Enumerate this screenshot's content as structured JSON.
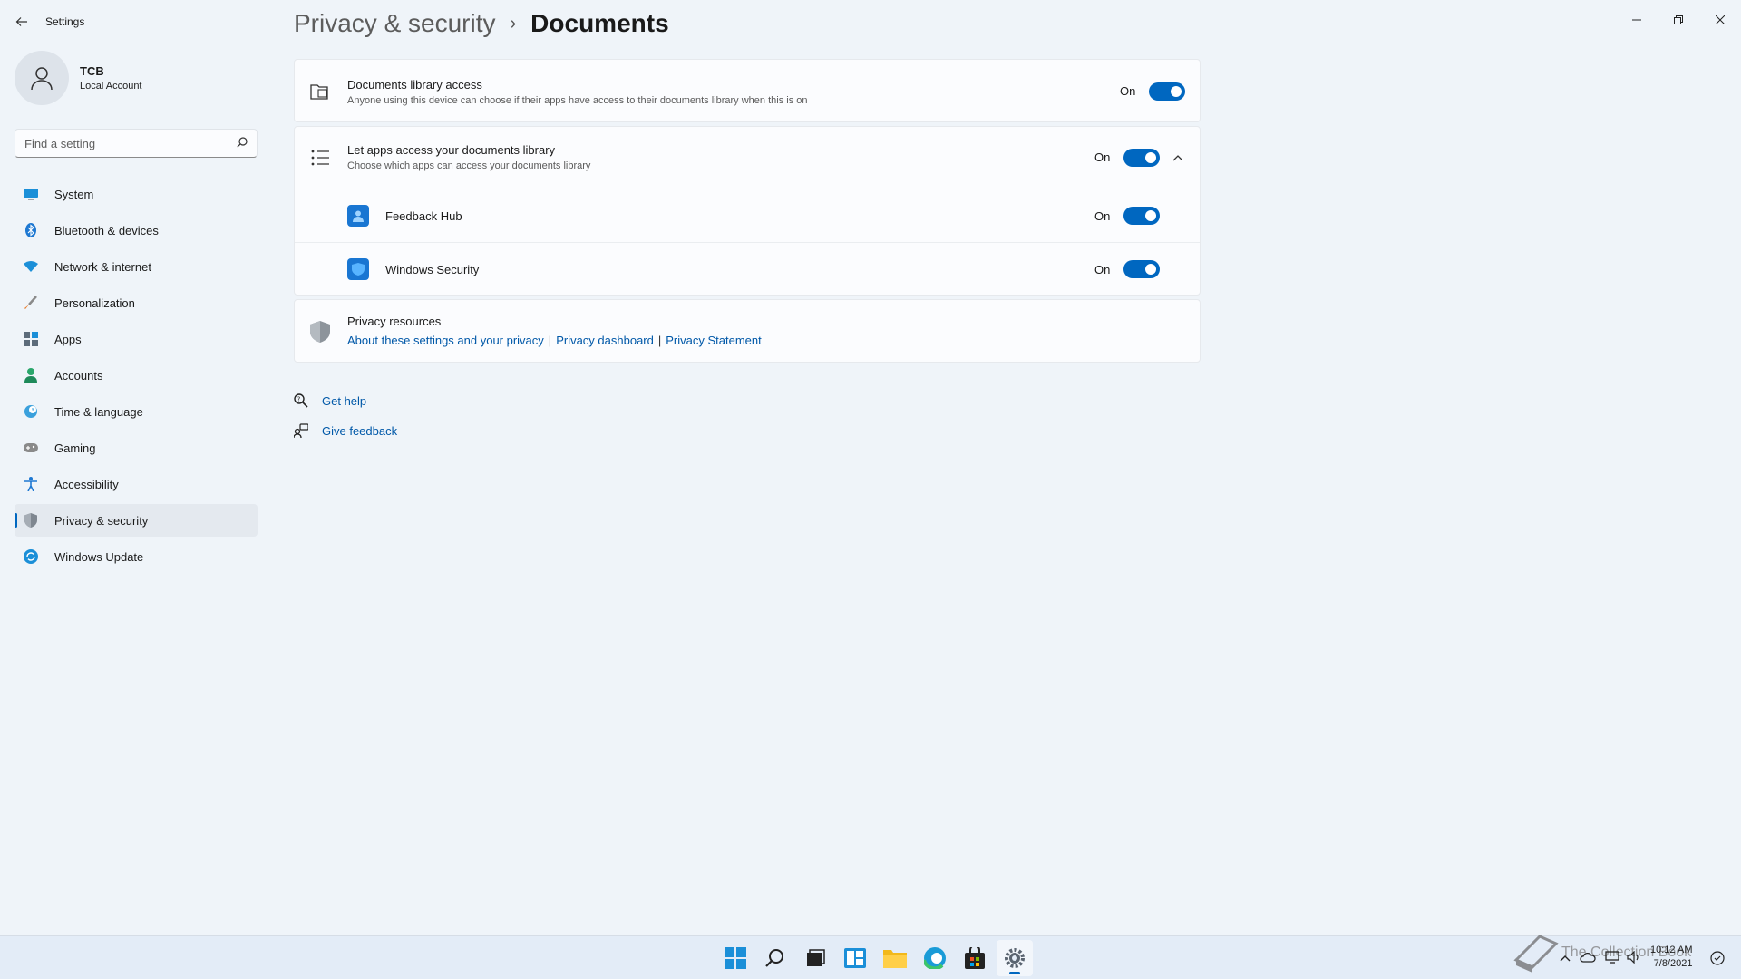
{
  "window": {
    "title": "Settings"
  },
  "user": {
    "name": "TCB",
    "type": "Local Account"
  },
  "search": {
    "placeholder": "Find a setting"
  },
  "sidebar": {
    "items": [
      {
        "label": "System",
        "icon": "monitor-icon"
      },
      {
        "label": "Bluetooth & devices",
        "icon": "bluetooth-icon"
      },
      {
        "label": "Network & internet",
        "icon": "wifi-icon"
      },
      {
        "label": "Personalization",
        "icon": "brush-icon"
      },
      {
        "label": "Apps",
        "icon": "apps-icon"
      },
      {
        "label": "Accounts",
        "icon": "person-icon"
      },
      {
        "label": "Time & language",
        "icon": "globe-clock-icon"
      },
      {
        "label": "Gaming",
        "icon": "gamepad-icon"
      },
      {
        "label": "Accessibility",
        "icon": "accessibility-icon"
      },
      {
        "label": "Privacy & security",
        "icon": "shield-icon",
        "active": true
      },
      {
        "label": "Windows Update",
        "icon": "update-icon"
      }
    ]
  },
  "breadcrumb": {
    "parent": "Privacy & security",
    "separator": "›",
    "current": "Documents"
  },
  "settings": {
    "library_access": {
      "title": "Documents library access",
      "subtitle": "Anyone using this device can choose if their apps have access to their documents library when this is on",
      "state": "On"
    },
    "let_apps": {
      "title": "Let apps access your documents library",
      "subtitle": "Choose which apps can access your documents library",
      "state": "On"
    },
    "apps": [
      {
        "name": "Feedback Hub",
        "state": "On"
      },
      {
        "name": "Windows Security",
        "state": "On"
      }
    ]
  },
  "privacy_resources": {
    "title": "Privacy resources",
    "links": [
      "About these settings and your privacy",
      "Privacy dashboard",
      "Privacy Statement"
    ],
    "separator": "|"
  },
  "help": {
    "get_help": "Get help",
    "give_feedback": "Give feedback"
  },
  "taskbar": {
    "clock_time": "10:12 AM",
    "clock_date": "7/8/2021",
    "watermark": "The Collection Book"
  },
  "colors": {
    "accent": "#0067c0",
    "background": "#eff4f9",
    "card": "#fbfcfe"
  }
}
